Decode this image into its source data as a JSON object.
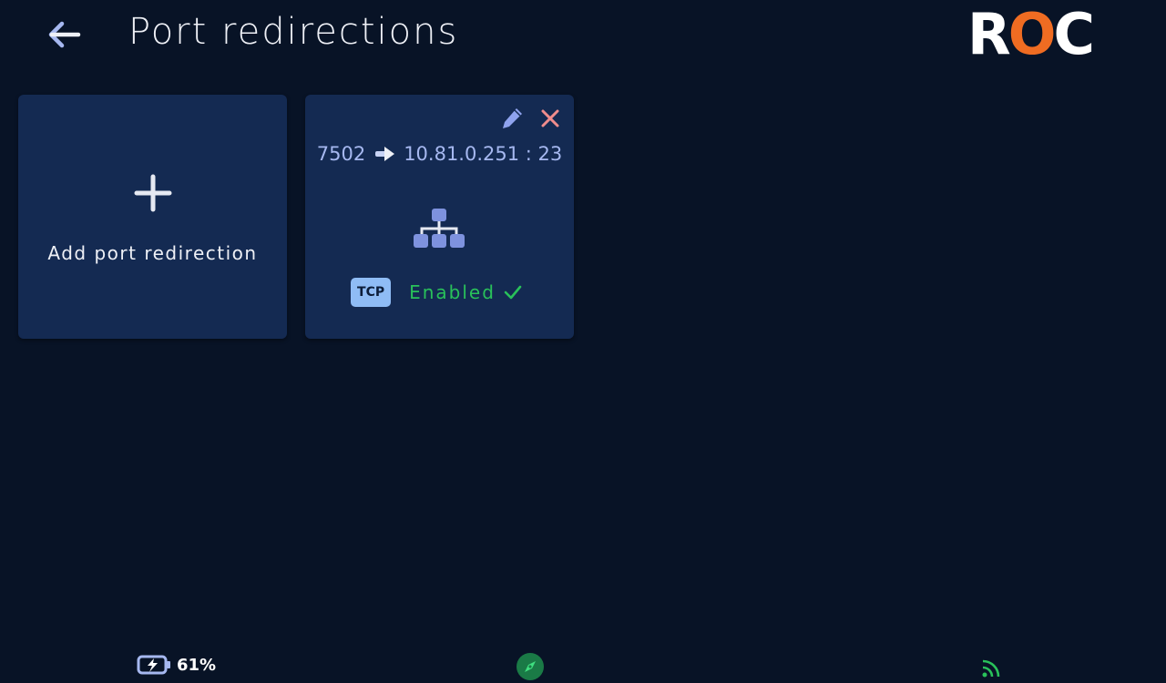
{
  "header": {
    "title": "Port redirections",
    "back_icon": "arrow-left-icon",
    "logo": {
      "r": "R",
      "o": "O",
      "c": "C",
      "accent": "#ef6c22"
    }
  },
  "add_card": {
    "label": "Add port redirection",
    "icon": "plus-icon"
  },
  "redirections": [
    {
      "source_port": "7502",
      "destination": "10.81.0.251 : 23",
      "protocol": "TCP",
      "status": "Enabled",
      "status_color": "#29c15a"
    }
  ],
  "statusbar": {
    "battery_percent": "61%",
    "battery_icon": "battery-charging-icon",
    "compass_icon": "compass-icon",
    "signal_icon": "signal-icon"
  }
}
